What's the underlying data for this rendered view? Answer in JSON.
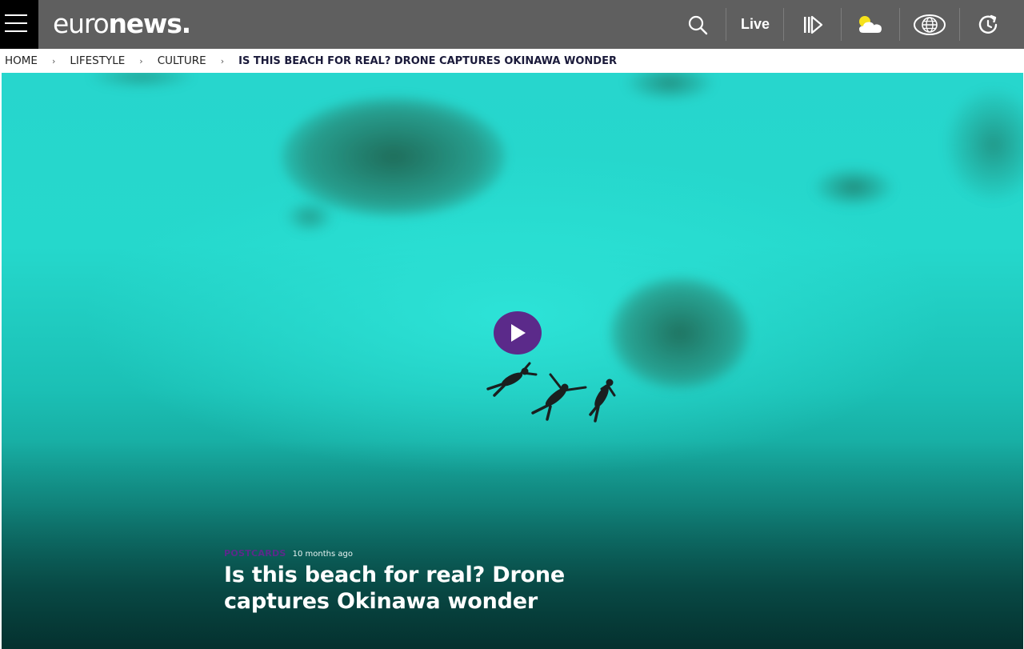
{
  "header": {
    "logo_regular": "euro",
    "logo_bold": "news",
    "logo_dot": ".",
    "live_label": "Live",
    "icons": [
      "menu-icon",
      "search-icon",
      "video-stories-icon",
      "weather-icon",
      "globe-icon",
      "refresh-icon"
    ]
  },
  "breadcrumb": {
    "items": [
      "HOME",
      "LIFESTYLE",
      "CULTURE"
    ],
    "separator": "›",
    "current": "IS THIS BEACH FOR REAL? DRONE CAPTURES OKINAWA WONDER"
  },
  "article": {
    "category": "POSTCARDS",
    "time_ago": "10 months ago",
    "headline": "Is this beach for real? Drone captures Okinawa wonder"
  },
  "colors": {
    "header_bg": "#5f5f5f",
    "accent_purple": "#5b2a8a",
    "water": "#25d8cc"
  }
}
